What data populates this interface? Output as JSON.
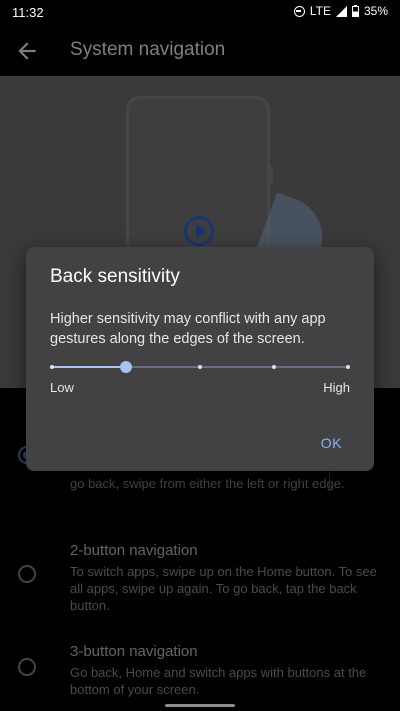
{
  "status_bar": {
    "time": "11:32",
    "network": "LTE",
    "battery": "35%"
  },
  "app_bar": {
    "title": "System navigation"
  },
  "options": [
    {
      "title": "",
      "description": "go back, swipe from either the left or right edge.",
      "selected": true
    },
    {
      "title": "2-button navigation",
      "description": "To switch apps, swipe up on the Home button. To see all apps, swipe up again. To go back, tap the back button.",
      "selected": false
    },
    {
      "title": "3-button navigation",
      "description": "Go back, Home and switch apps with buttons at the bottom of your screen.",
      "selected": false
    }
  ],
  "dialog": {
    "title": "Back sensitivity",
    "body": "Higher sensitivity may conflict with any app gestures along the edges of the screen.",
    "slider": {
      "min_label": "Low",
      "max_label": "High",
      "steps": 4,
      "value": 1
    },
    "ok_label": "OK"
  },
  "colors": {
    "accent": "#8ab4f8",
    "slider_active": "#a8c3ee",
    "dialog_bg": "#424244"
  }
}
